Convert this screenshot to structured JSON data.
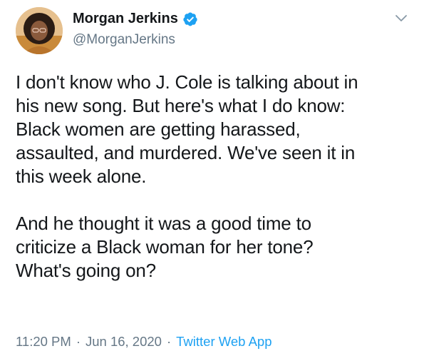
{
  "author": {
    "display_name": "Morgan Jerkins",
    "handle": "@MorganJerkins",
    "verified": true,
    "avatar_icon": "profile-photo"
  },
  "tweet": {
    "paragraphs": [
      "I don't know who J. Cole is talking about in\nhis new song. But here's what I do know:\nBlack women are getting harassed,\nassaulted, and murdered. We've seen it in\nthis week alone.",
      "And he thought it was a good time to\ncriticize a Black woman for her tone?\nWhat's going on?"
    ]
  },
  "meta": {
    "time": "11:20 PM",
    "date": "Jun 16, 2020",
    "separator": "·",
    "source": "Twitter Web App"
  },
  "colors": {
    "text": "#14171a",
    "secondary": "#657786",
    "accent": "#1da1f2"
  }
}
